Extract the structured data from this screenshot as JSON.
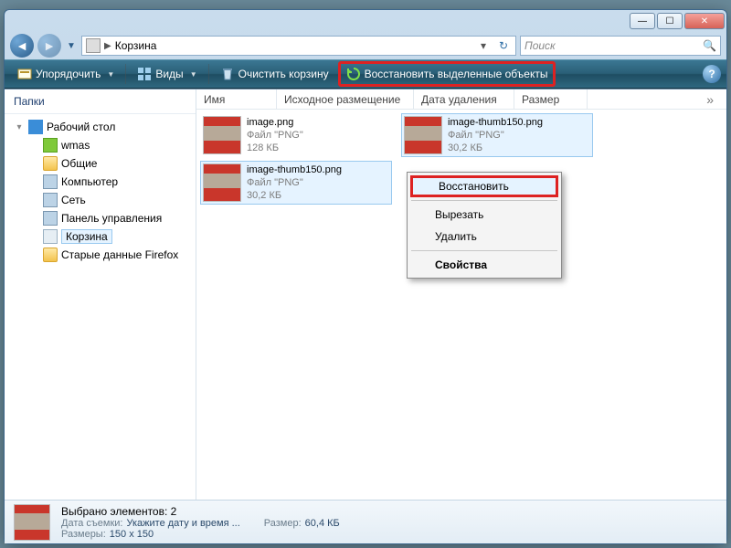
{
  "titlebar": {
    "blur_text": ""
  },
  "nav": {
    "breadcrumb_location": "Корзина",
    "search_placeholder": "Поиск"
  },
  "toolbar": {
    "organize": "Упорядочить",
    "views": "Виды",
    "empty_bin": "Очистить корзину",
    "restore_selected": "Восстановить выделенные объекты"
  },
  "sidebar": {
    "header": "Папки",
    "items": [
      {
        "label": "Рабочий стол",
        "icon": "desktop",
        "level": 0
      },
      {
        "label": "wmas",
        "icon": "green",
        "level": 1
      },
      {
        "label": "Общие",
        "icon": "folder",
        "level": 1
      },
      {
        "label": "Компьютер",
        "icon": "computer",
        "level": 1
      },
      {
        "label": "Сеть",
        "icon": "network",
        "level": 1
      },
      {
        "label": "Панель управления",
        "icon": "ctrl",
        "level": 1
      },
      {
        "label": "Корзина",
        "icon": "bin",
        "level": 1,
        "selected": true
      },
      {
        "label": "Старые данные Firefox",
        "icon": "folder",
        "level": 1
      }
    ]
  },
  "columns": {
    "c1": "Имя",
    "c2": "Исходное размещение",
    "c3": "Дата удаления",
    "c4": "Размер"
  },
  "files": [
    {
      "name": "image.png",
      "type": "Файл \"PNG\"",
      "size": "128 КБ",
      "selected": false
    },
    {
      "name": "image-thumb150.png",
      "type": "Файл \"PNG\"",
      "size": "30,2 КБ",
      "selected": true
    },
    {
      "name": "image-thumb150.png",
      "type": "Файл \"PNG\"",
      "size": "30,2 КБ",
      "selected": true
    }
  ],
  "context_menu": {
    "restore": "Восстановить",
    "cut": "Вырезать",
    "delete": "Удалить",
    "properties": "Свойства"
  },
  "statusbar": {
    "title": "Выбрано элементов: 2",
    "date_key": "Дата съемки:",
    "date_val": "Укажите дату и время ...",
    "dims_key": "Размеры:",
    "dims_val": "150 x 150",
    "size_key": "Размер:",
    "size_val": "60,4 КБ"
  }
}
